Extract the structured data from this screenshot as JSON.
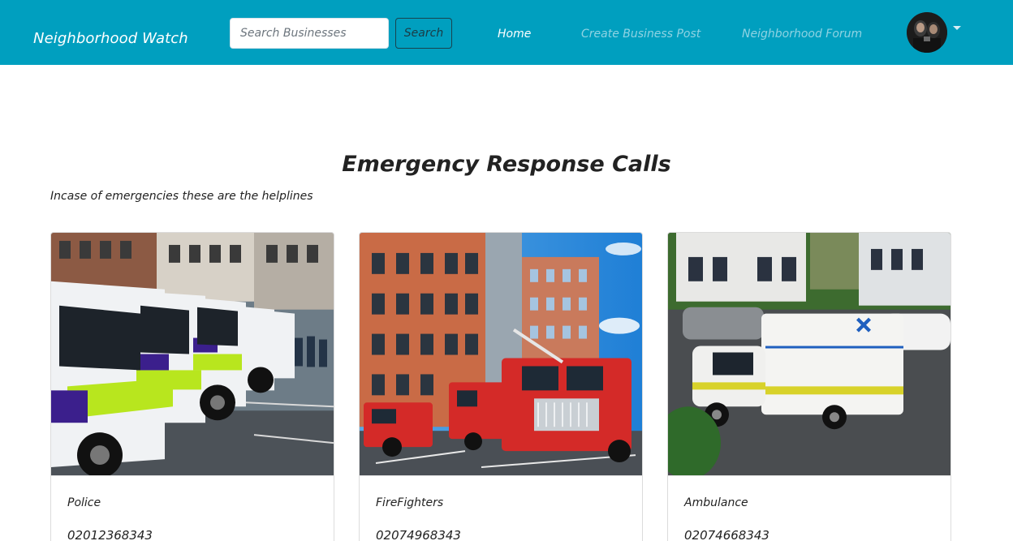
{
  "navbar": {
    "brand": "Neighborhood Watch",
    "search": {
      "placeholder": "Search Businesses",
      "value": "",
      "button_label": "Search"
    },
    "links": [
      {
        "label": "Home",
        "active": true
      },
      {
        "label": "Create Business Post",
        "active": false
      },
      {
        "label": "Neighborhood Forum",
        "active": false
      }
    ],
    "colors": {
      "bar": "#009fbf",
      "active_link": "#ffffff",
      "inactive_link": "#8fd3e3"
    }
  },
  "main": {
    "title": "Emergency Response Calls",
    "subtitle": "Incase of emergencies these are the helplines",
    "cards": [
      {
        "name": "Police",
        "phone": "02012368343",
        "image": "police-vans-photo"
      },
      {
        "name": "FireFighters",
        "phone": "02074968343",
        "image": "fire-trucks-photo"
      },
      {
        "name": "Ambulance",
        "phone": "02074668343",
        "image": "ambulance-photo"
      }
    ]
  }
}
